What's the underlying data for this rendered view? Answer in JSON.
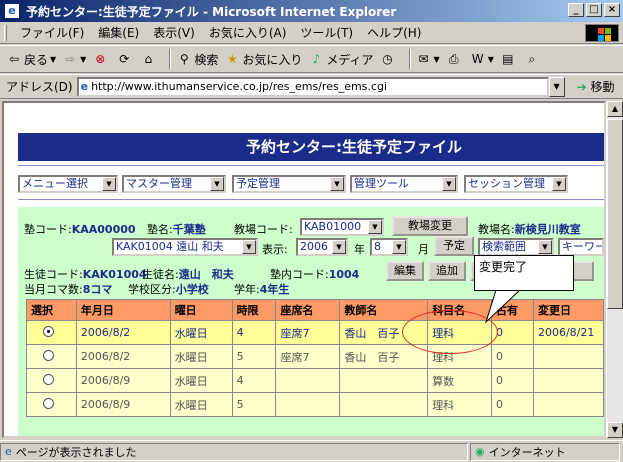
{
  "window": {
    "title": "予約センター:生徒予定ファイル - Microsoft Internet Explorer",
    "buttons": {
      "minimize": "_",
      "maximize": "□",
      "close": "×"
    }
  },
  "menu": [
    "ファイル(F)",
    "編集(E)",
    "表示(V)",
    "お気に入り(A)",
    "ツール(T)",
    "ヘルプ(H)"
  ],
  "toolbar": {
    "back": "戻る",
    "search": "検索",
    "favorites": "お気に入り",
    "media": "メディア"
  },
  "address": {
    "label": "アドレス(D)",
    "url": "http://www.ithumanservice.co.jp/res_ems/res_ems.cgi",
    "go": "移動"
  },
  "page": {
    "banner": "予約センター:生徒予定ファイル",
    "nav": [
      {
        "label": "メニュー選択"
      },
      {
        "label": "マスター管理"
      },
      {
        "label": "予定管理"
      },
      {
        "label": "管理ツール"
      },
      {
        "label": "セッション管理"
      }
    ],
    "juku_code_label": "塾コード:",
    "juku_code": "KAA00000",
    "juku_name_label": "塾名:",
    "juku_name": "千葉塾",
    "classroom_code_label": "教場コード:",
    "classroom_code": "KAB01000",
    "classroom_change_button": "教場変更",
    "classroom_name_label": "教場名:",
    "classroom_name": "新検見川教室",
    "teacher_select": "KAK01004 遠山 和夫",
    "display_label": "表示:",
    "year_value": "2006",
    "year_label": "年",
    "month_value": "8",
    "month_label": "月",
    "schedule_button": "予定",
    "search_range": "検索範囲",
    "keyword": "キーワー",
    "student_code_label": "生徒コード:",
    "student_code": "KAK01004",
    "student_name_label": "生徒名:",
    "student_name": "遠山　和夫",
    "in_juku_code_label": "塾内コード:",
    "in_juku_code": "1004",
    "edit_button": "編集",
    "add_button": "追加",
    "monthly_count_label": "当月コマ数:",
    "monthly_count": "8コマ",
    "school_type_label": "学校区分:",
    "school_type": "小学校",
    "grade_label": "学年:",
    "grade": "4年生",
    "table": {
      "headers": [
        "選択",
        "年月日",
        "曜日",
        "時限",
        "座席名",
        "教師名",
        "科目名",
        "古有",
        "変更日"
      ],
      "rows": [
        {
          "selected": true,
          "date": "2006/8/2",
          "weekday": "水曜日",
          "period": "4",
          "seat": "座席7",
          "teacher": "香山　百子",
          "subject": "理科",
          "flag": "0",
          "changed": "2006/8/21"
        },
        {
          "selected": false,
          "date": "2006/8/2",
          "weekday": "水曜日",
          "period": "5",
          "seat": "座席7",
          "teacher": "香山　百子",
          "subject": "理科",
          "flag": "0",
          "changed": ""
        },
        {
          "selected": false,
          "date": "2006/8/9",
          "weekday": "水曜日",
          "period": "4",
          "seat": "",
          "teacher": "",
          "subject": "算数",
          "flag": "0",
          "changed": ""
        },
        {
          "selected": false,
          "date": "2006/8/9",
          "weekday": "水曜日",
          "period": "5",
          "seat": "",
          "teacher": "",
          "subject": "理科",
          "flag": "0",
          "changed": ""
        }
      ]
    },
    "callout_text": "変更完了"
  },
  "status": {
    "left": "ページが表示されました",
    "zone": "インターネット"
  },
  "colors": {
    "banner": "#1b2b8a",
    "panel": "#ccffcc",
    "header": "#ff9966",
    "row": "#ffffcc"
  }
}
